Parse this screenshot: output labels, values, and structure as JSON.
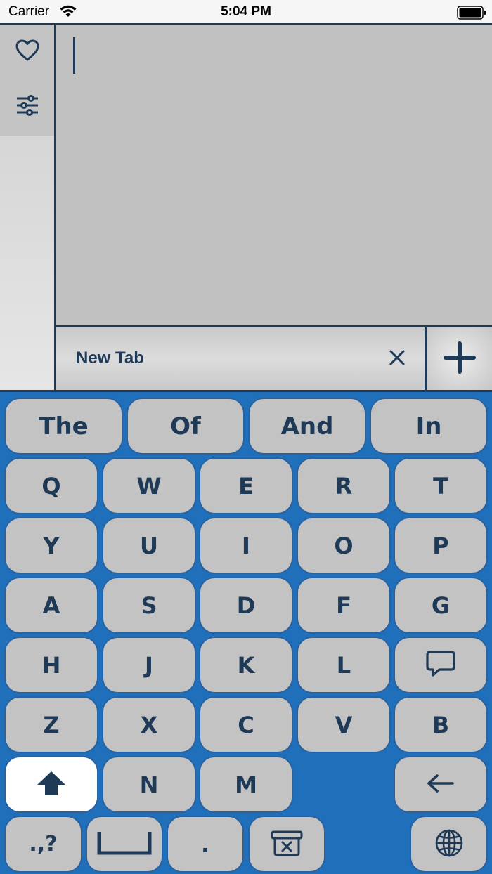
{
  "status_bar": {
    "carrier": "Carrier",
    "time": "5:04 PM"
  },
  "sidebar": {
    "items": [
      {
        "icon": "heart-icon"
      },
      {
        "icon": "sliders-icon"
      }
    ]
  },
  "tabs": [
    {
      "label": "New Tab"
    }
  ],
  "suggestions": [
    "The",
    "Of",
    "And",
    "In"
  ],
  "rows": [
    [
      "Q",
      "W",
      "E",
      "R",
      "T"
    ],
    [
      "Y",
      "U",
      "I",
      "O",
      "P"
    ],
    [
      "A",
      "S",
      "D",
      "F",
      "G"
    ],
    [
      "H",
      "J",
      "K",
      "L"
    ],
    [
      "Z",
      "X",
      "C",
      "V",
      "B"
    ],
    [
      "N",
      "M"
    ]
  ],
  "bottom_row": {
    "punctuation_label": ".,?",
    "period_label": "."
  },
  "colors": {
    "keyboard_bg": "#1f6fba",
    "key_bg": "#c3c3c3",
    "key_text": "#1f3a57",
    "shift_bg": "#ffffff"
  }
}
